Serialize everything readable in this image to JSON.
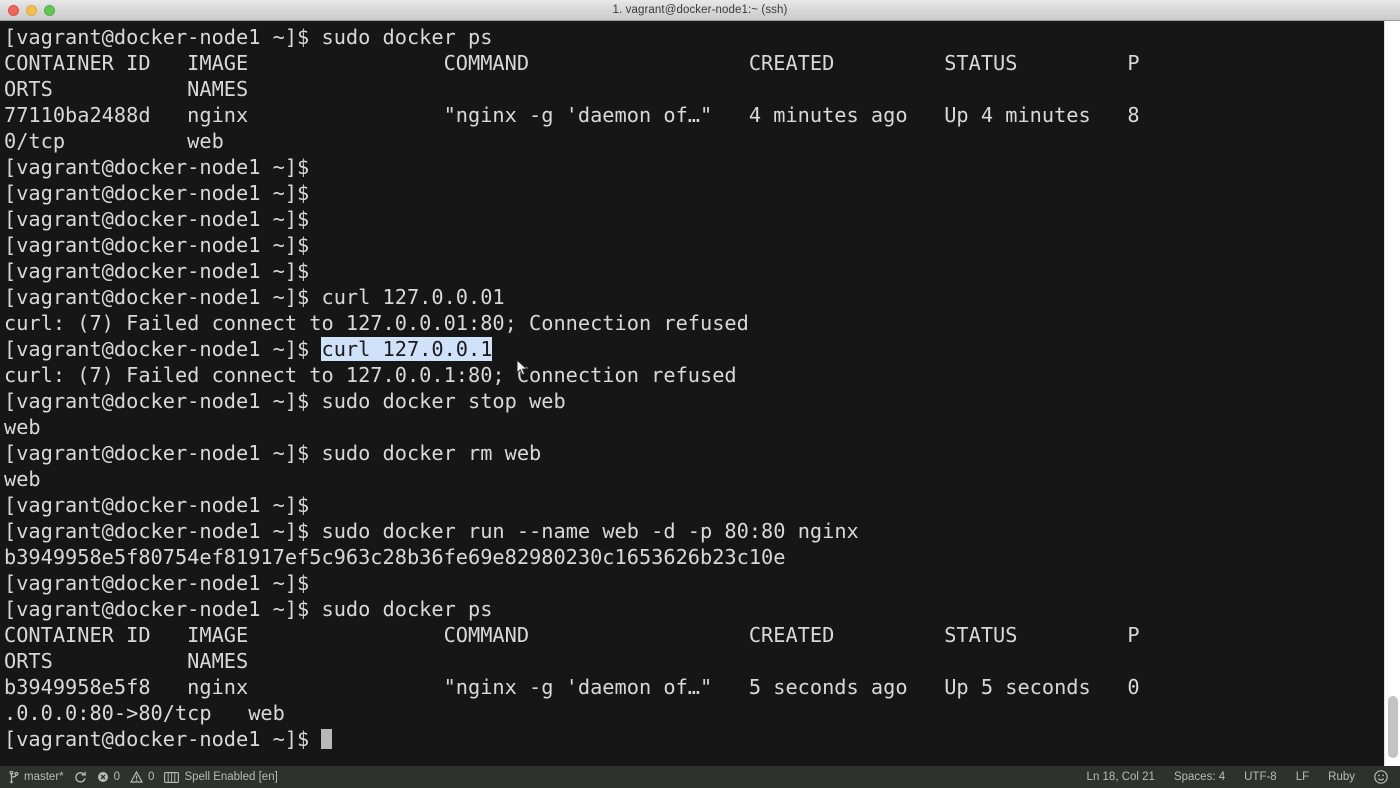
{
  "window": {
    "title": "1. vagrant@docker-node1:~ (ssh)",
    "controls": {
      "close": "close-button",
      "minimize": "minimize-button",
      "zoom": "zoom-button"
    }
  },
  "terminal": {
    "prompt": "[vagrant@docker-node1 ~]$ ",
    "selection_text": "curl 127.0.0.1",
    "cursor": "block-cursor",
    "lines": [
      {
        "type": "command",
        "prompt": "[vagrant@docker-node1 ~]$ ",
        "text": "sudo docker ps"
      },
      {
        "type": "output",
        "text": "CONTAINER ID   IMAGE                COMMAND                  CREATED         STATUS         P"
      },
      {
        "type": "output",
        "text": "ORTS           NAMES"
      },
      {
        "type": "output",
        "text": "77110ba2488d   nginx                \"nginx -g 'daemon of…\"   4 minutes ago   Up 4 minutes   8"
      },
      {
        "type": "output",
        "text": "0/tcp          web"
      },
      {
        "type": "command",
        "prompt": "[vagrant@docker-node1 ~]$ ",
        "text": ""
      },
      {
        "type": "command",
        "prompt": "[vagrant@docker-node1 ~]$ ",
        "text": ""
      },
      {
        "type": "command",
        "prompt": "[vagrant@docker-node1 ~]$ ",
        "text": ""
      },
      {
        "type": "command",
        "prompt": "[vagrant@docker-node1 ~]$ ",
        "text": ""
      },
      {
        "type": "command",
        "prompt": "[vagrant@docker-node1 ~]$ ",
        "text": ""
      },
      {
        "type": "command",
        "prompt": "[vagrant@docker-node1 ~]$ ",
        "text": "curl 127.0.0.01"
      },
      {
        "type": "output",
        "text": "curl: (7) Failed connect to 127.0.0.01:80; Connection refused"
      },
      {
        "type": "command-selected",
        "prompt": "[vagrant@docker-node1 ~]$ ",
        "text": "curl 127.0.0.1"
      },
      {
        "type": "output",
        "text": "curl: (7) Failed connect to 127.0.0.1:80; Connection refused"
      },
      {
        "type": "command",
        "prompt": "[vagrant@docker-node1 ~]$ ",
        "text": "sudo docker stop web"
      },
      {
        "type": "output",
        "text": "web"
      },
      {
        "type": "command",
        "prompt": "[vagrant@docker-node1 ~]$ ",
        "text": "sudo docker rm web"
      },
      {
        "type": "output",
        "text": "web"
      },
      {
        "type": "command",
        "prompt": "[vagrant@docker-node1 ~]$ ",
        "text": ""
      },
      {
        "type": "command",
        "prompt": "[vagrant@docker-node1 ~]$ ",
        "text": "sudo docker run --name web -d -p 80:80 nginx"
      },
      {
        "type": "output",
        "text": "b3949958e5f80754ef81917ef5c963c28b36fe69e82980230c1653626b23c10e"
      },
      {
        "type": "command",
        "prompt": "[vagrant@docker-node1 ~]$ ",
        "text": ""
      },
      {
        "type": "command",
        "prompt": "[vagrant@docker-node1 ~]$ ",
        "text": "sudo docker ps"
      },
      {
        "type": "output",
        "text": "CONTAINER ID   IMAGE                COMMAND                  CREATED         STATUS         P"
      },
      {
        "type": "output",
        "text": "ORTS           NAMES"
      },
      {
        "type": "output",
        "text": "b3949958e5f8   nginx                \"nginx -g 'daemon of…\"   5 seconds ago   Up 5 seconds   0"
      },
      {
        "type": "output",
        "text": ".0.0.0:80->80/tcp   web"
      },
      {
        "type": "prompt-cursor",
        "prompt": "[vagrant@docker-node1 ~]$ ",
        "text": ""
      }
    ]
  },
  "scrollbar": {
    "name": "vertical-scrollbar"
  },
  "statusbar": {
    "branch": "master*",
    "branch_icon": "git-branch-icon",
    "sync_icon": "refresh-icon",
    "errors": "0",
    "error_icon": "error-circle-icon",
    "warnings": "0",
    "warning_icon": "warning-triangle-icon",
    "spell": "Spell Enabled [en]",
    "spell_icon": "spell-check-icon",
    "line_col": "Ln 18, Col 21",
    "indentation": "Spaces: 4",
    "encoding": "UTF-8",
    "line_ending": "LF",
    "language": "Ruby",
    "feedback_icon": "smiley-icon"
  },
  "colors": {
    "terminal_bg": "#161616",
    "terminal_fg": "#d8d8d8",
    "selection_bg": "#cfe2fa",
    "statusbar_bg": "#2f312c",
    "titlebar_bg": "#d6d6d6"
  }
}
